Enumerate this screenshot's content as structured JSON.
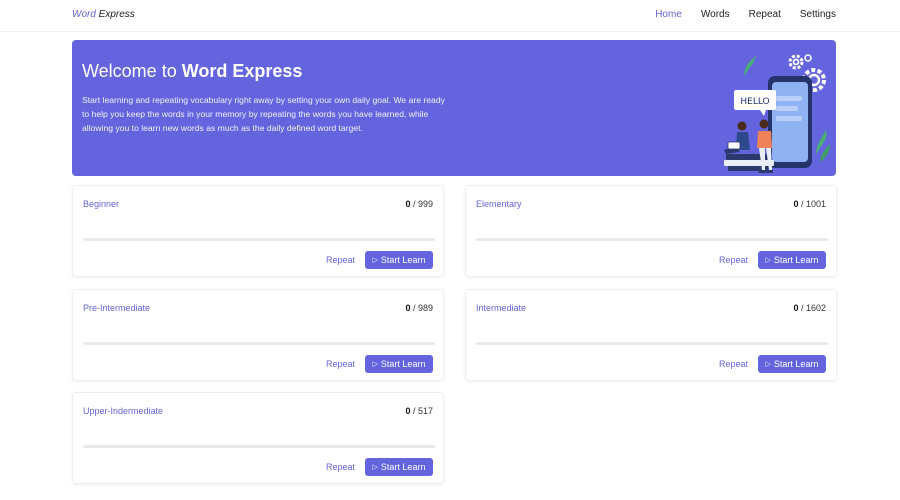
{
  "header": {
    "brand_word": "Word",
    "brand_rest": " Express",
    "nav": [
      "Home",
      "Words",
      "Repeat",
      "Settings"
    ],
    "active": "Home"
  },
  "hero": {
    "title_prefix": "Welcome to ",
    "title_bold": "Word Express",
    "description": "Start learning and repeating vocabulary right away by setting your own daily goal. We are ready to help you keep the words in your memory by repeating the words you have learned, while allowing you to learn new words as much as the daily defined word target.",
    "illustration_text": "HELLO"
  },
  "actions": {
    "repeat_label": "Repeat",
    "learn_label": "Start Learn",
    "learn_icon": "play-icon"
  },
  "levels": [
    {
      "name": "Beginner",
      "learned": "0",
      "total": "999",
      "progress": 0
    },
    {
      "name": "Elementary",
      "learned": "0",
      "total": "1001",
      "progress": 0
    },
    {
      "name": "Pre-Intermediate",
      "learned": "0",
      "total": "989",
      "progress": 0
    },
    {
      "name": "Intermediate",
      "learned": "0",
      "total": "1602",
      "progress": 0
    },
    {
      "name": "Upper-Indermediate",
      "learned": "0",
      "total": "517",
      "progress": 0
    }
  ],
  "colors": {
    "accent": "#6364d7",
    "hero_bg": "#6364de",
    "track": "#e8e9ed"
  }
}
